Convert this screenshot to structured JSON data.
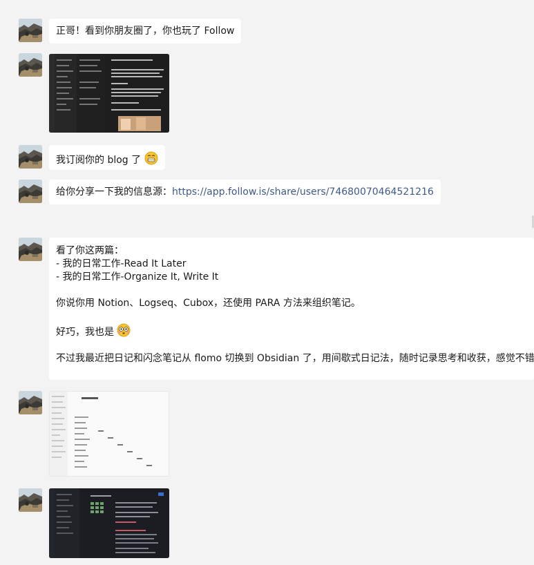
{
  "messages": {
    "m1": {
      "text": "正哥！看到你朋友圈了，你也玩了 Follow"
    },
    "m3": {
      "text": "我订阅你的 blog 了",
      "emoji": "grinning-face-emoji"
    },
    "m4": {
      "prefix": "给你分享一下我的信息源：",
      "link": "https://app.follow.is/share/users/74680070464521216"
    },
    "m5": {
      "lines": [
        "看了你这两篇：",
        "- 我的日常工作-Read It Later",
        "- 我的日常工作-Organize It, Write It",
        "",
        "你说你用 Notion、Logseq、Cubox，还使用 PARA 方法来组织笔记。",
        "",
        "好巧，我也是",
        "",
        "不过我最近把日记和闪念笔记从 flomo 切换到 Obsidian 了，用间歇式日记法，随时记录思考和收获，感觉不错"
      ],
      "emoji": "flushed-face-emoji"
    }
  },
  "icons": {
    "avatar": "mountain-avatar",
    "image_dark": "dark-app-screenshot",
    "image_light": "light-app-screenshot",
    "image_obsidian": "dark-obsidian-screenshot"
  }
}
